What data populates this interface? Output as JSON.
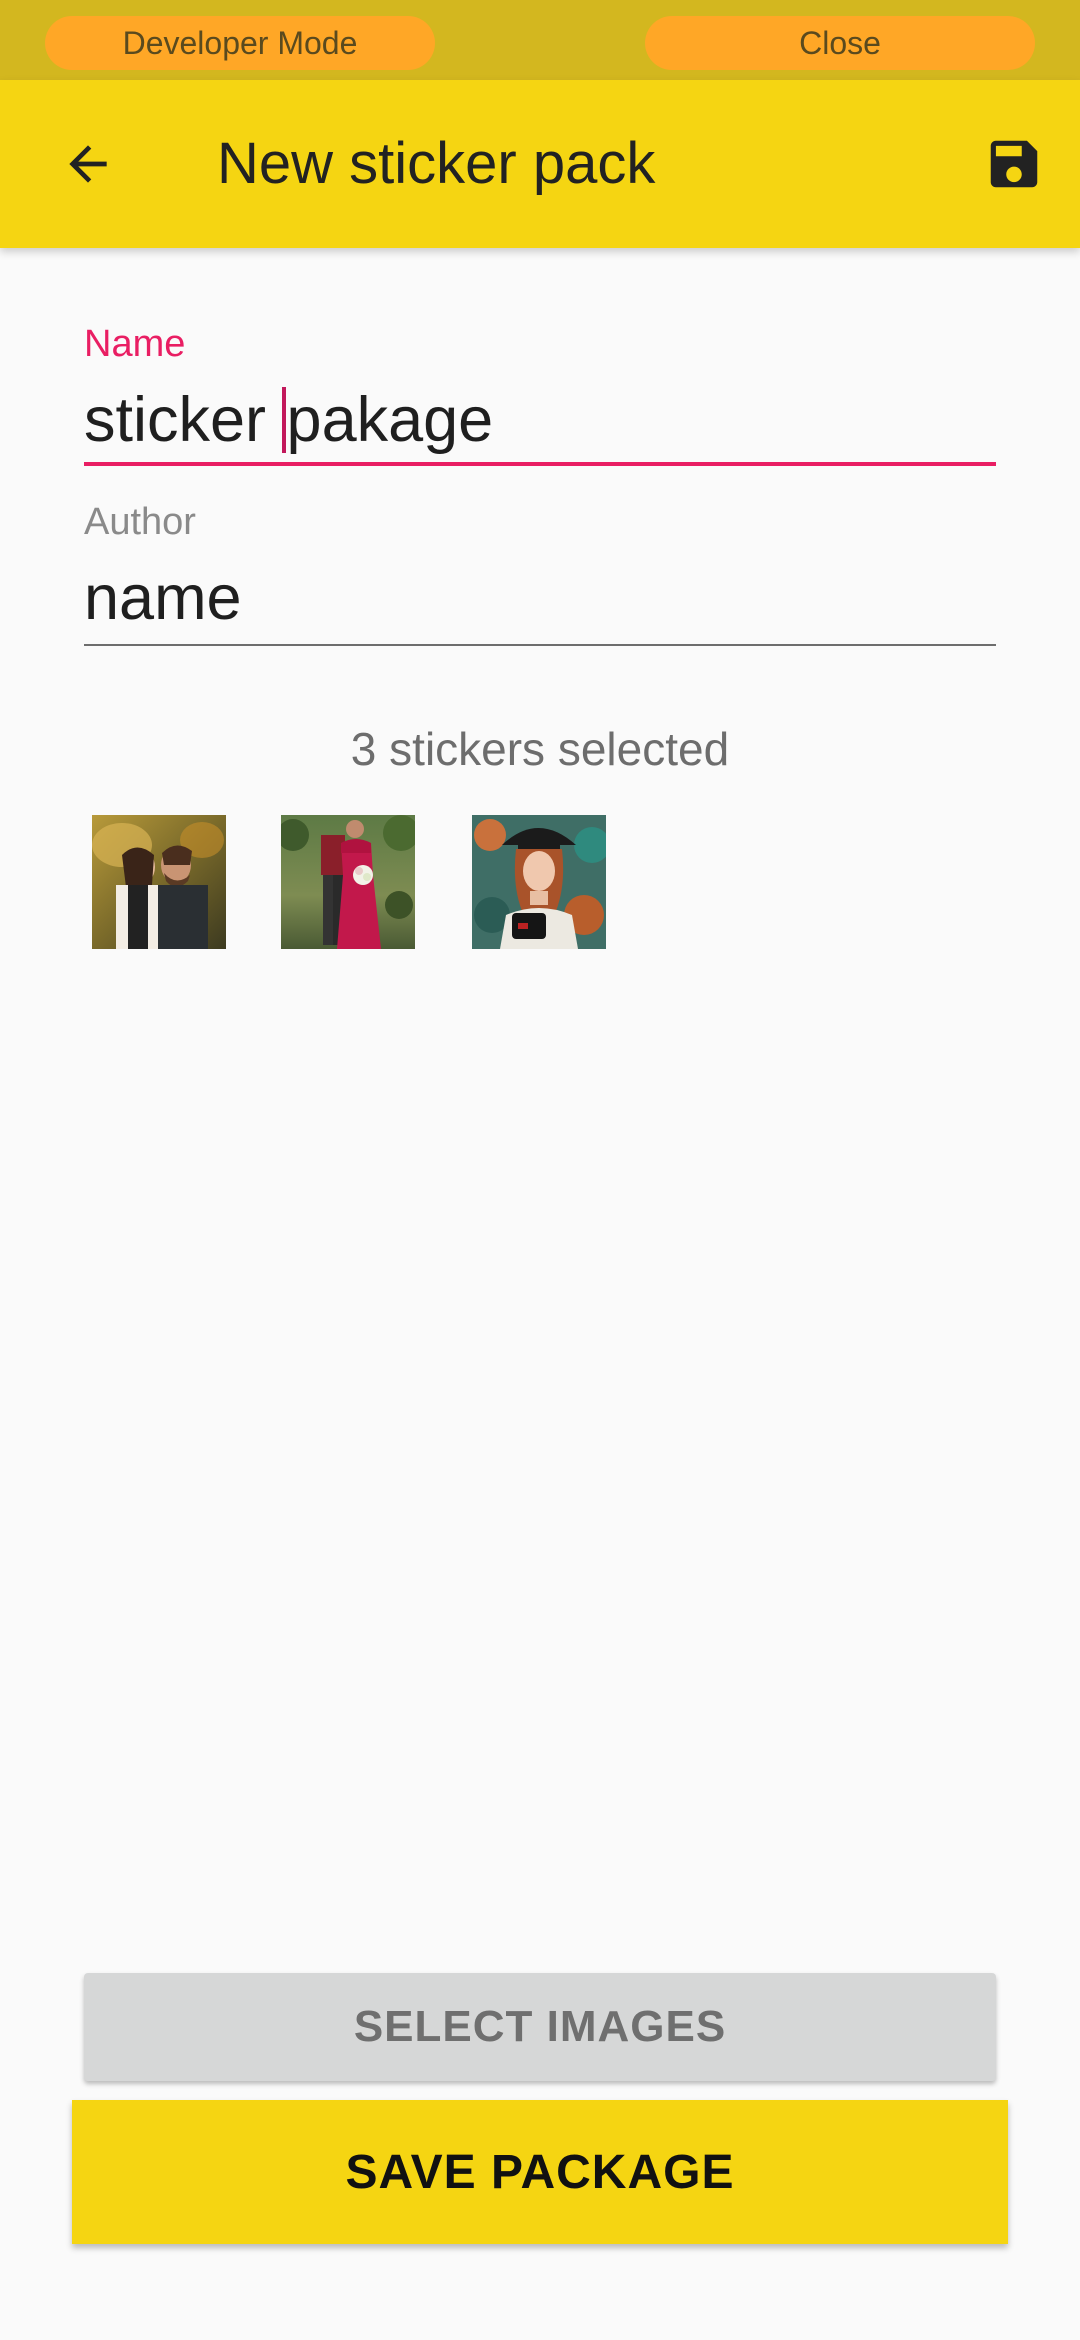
{
  "dev_bar": {
    "developer_mode_label": "Developer Mode",
    "close_label": "Close"
  },
  "app_bar": {
    "title": "New sticker pack",
    "back_icon": "arrow-back-icon",
    "save_icon": "floppy-disk-icon"
  },
  "form": {
    "name_label": "Name",
    "name_value_before_caret": "sticker ",
    "name_value_after_caret": "pakage",
    "author_label": "Author",
    "author_value": "name"
  },
  "selection": {
    "count_text": "3 stickers selected",
    "thumbnails": [
      "couple-kiss-photo",
      "couple-garden-photo",
      "woman-hat-photo"
    ]
  },
  "buttons": {
    "select_images": "SELECT IMAGES",
    "save_package": "SAVE PACKAGE"
  },
  "colors": {
    "dev_bar": "#d3b71f",
    "pill": "#ffa726",
    "app_bar": "#f5d512",
    "accent": "#e91e63"
  }
}
